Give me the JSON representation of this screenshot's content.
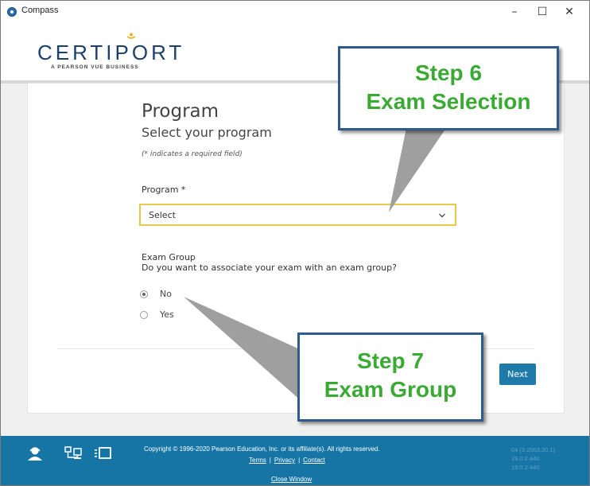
{
  "window": {
    "title": "Compass",
    "minimize": "–",
    "maximize": "☐",
    "close": "✕"
  },
  "header": {
    "logo_text": "CERTIPORT",
    "logo_tagline": "A PEARSON VUE BUSINESS"
  },
  "form": {
    "title": "Program",
    "subtitle": "Select your program",
    "required_note": "(* indicates a required field)",
    "program_label": "Program *",
    "program_select_value": "Select",
    "exam_group_label": "Exam Group",
    "exam_group_question": "Do you want to associate your exam with an exam group?",
    "radio_options": [
      {
        "label": "No",
        "checked": true
      },
      {
        "label": "Yes",
        "checked": false
      }
    ],
    "next_label": "Next"
  },
  "footer": {
    "icons": [
      "support-person-icon",
      "network-computer-icon",
      "display-icon"
    ],
    "copyright": "Copyright © 1996-2020 Pearson Education, Inc. or its affiliate(s). All rights reserved.",
    "links": [
      "Terms",
      "Privacy",
      "Contact"
    ],
    "link_separator": "|",
    "close_window": "Close Window",
    "versions": [
      "04 (3.2003.20.1)",
      "19.0.2.440",
      "19.0.2.440"
    ]
  },
  "annotations": {
    "step6": {
      "line1": "Step 6",
      "line2": "Exam Selection"
    },
    "step7": {
      "line1": "Step 7",
      "line2": "Exam Group"
    }
  },
  "colors": {
    "brand_navy": "#1b3f6e",
    "footer_blue": "#1775a6",
    "next_button": "#1e7aa8",
    "select_focus_border": "#e8c84a",
    "callout_border": "#2f5b8c",
    "callout_text": "#3aaa35"
  }
}
